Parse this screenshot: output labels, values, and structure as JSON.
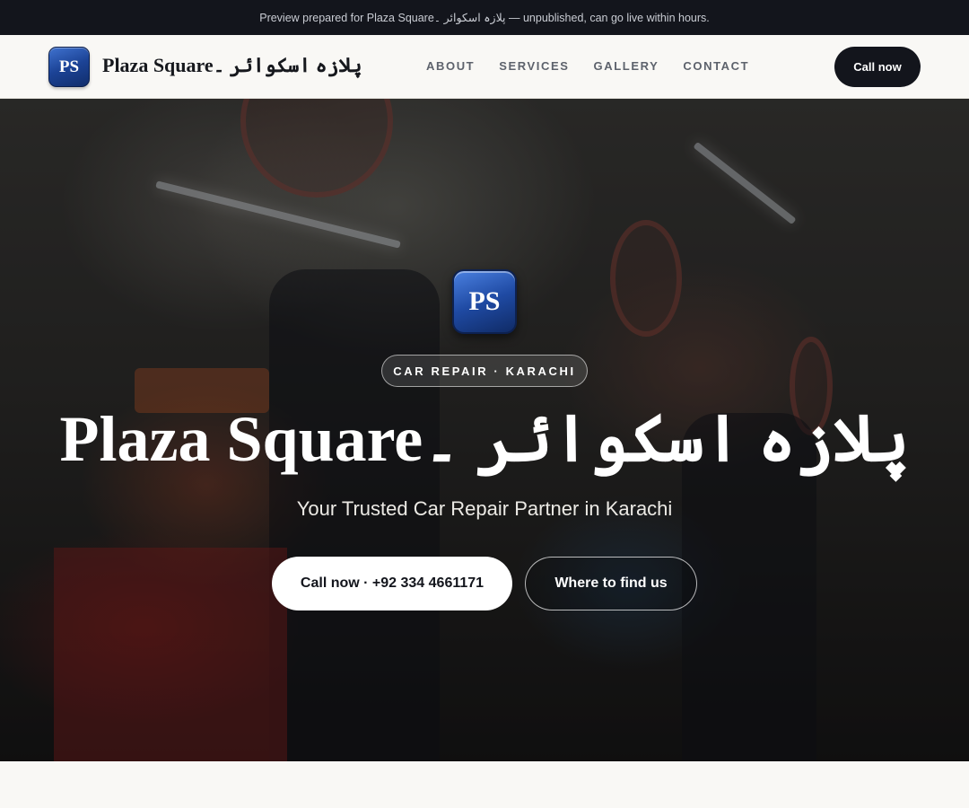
{
  "banner": {
    "text": "Preview prepared for Plaza Squareپلازہ اسکوائر ۔ — unpublished, can go live within hours."
  },
  "header": {
    "logo_text": "PS",
    "brand_name": "Plaza Squareپلازہ اسکوائر ۔",
    "nav": [
      "ABOUT",
      "SERVICES",
      "GALLERY",
      "CONTACT"
    ],
    "cta_label": "Call now"
  },
  "hero": {
    "logo_text": "PS",
    "tag": "CAR REPAIR · KARACHI",
    "title": "Plaza Squareپلازہ اسکوائر ۔",
    "subtitle": "Your Trusted Car Repair Partner in Karachi",
    "primary_button": "Call now · +92 334 4661171",
    "secondary_button": "Where to find us"
  },
  "colors": {
    "dark": "#13151c",
    "accent_blue": "#1c4396",
    "page_bg": "#f9f8f5"
  }
}
